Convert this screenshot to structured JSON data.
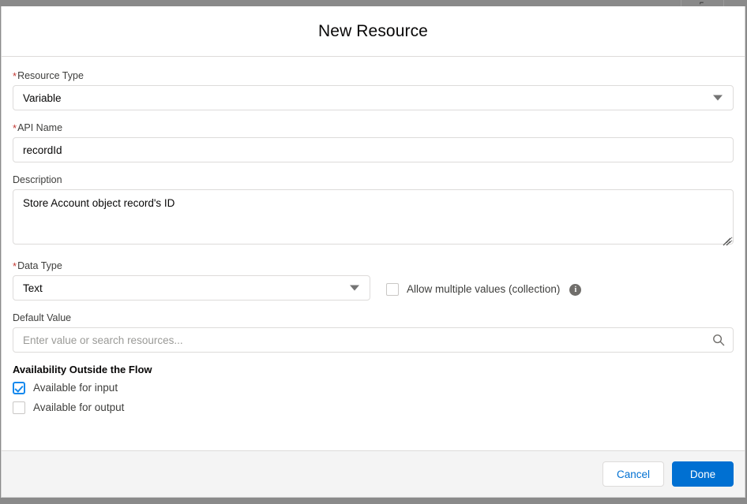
{
  "background": {
    "top_tick_glyph": "⌐"
  },
  "modal": {
    "title": "New Resource",
    "fields": {
      "resource_type": {
        "label": "Resource Type",
        "required_marker": "*",
        "value": "Variable",
        "caret_icon": "chevron-down-icon"
      },
      "api_name": {
        "label": "API Name",
        "required_marker": "*",
        "value": "recordId",
        "placeholder": ""
      },
      "description": {
        "label": "Description",
        "value": "Store Account object record's ID",
        "placeholder": ""
      },
      "data_type": {
        "label": "Data Type",
        "required_marker": "*",
        "value": "Text",
        "caret_icon": "chevron-down-icon"
      },
      "allow_multiple": {
        "label": "Allow multiple values (collection)",
        "checked": false,
        "info_icon": "info-icon",
        "info_glyph": "i"
      },
      "default_value": {
        "label": "Default Value",
        "value": "",
        "placeholder": "Enter value or search resources...",
        "search_icon": "search-icon"
      }
    },
    "availability": {
      "title": "Availability Outside the Flow",
      "options": [
        {
          "label": "Available for input",
          "checked": true
        },
        {
          "label": "Available for output",
          "checked": false
        }
      ]
    },
    "footer": {
      "cancel_label": "Cancel",
      "done_label": "Done"
    }
  },
  "colors": {
    "brand_blue": "#0070d2",
    "link_blue": "#0070d2",
    "checkbox_blue": "#1589ee",
    "required_red": "#c23934",
    "footer_bg": "#f4f4f4",
    "border_gray": "#dddbda",
    "page_bg_gray": "#8a8a8a"
  }
}
